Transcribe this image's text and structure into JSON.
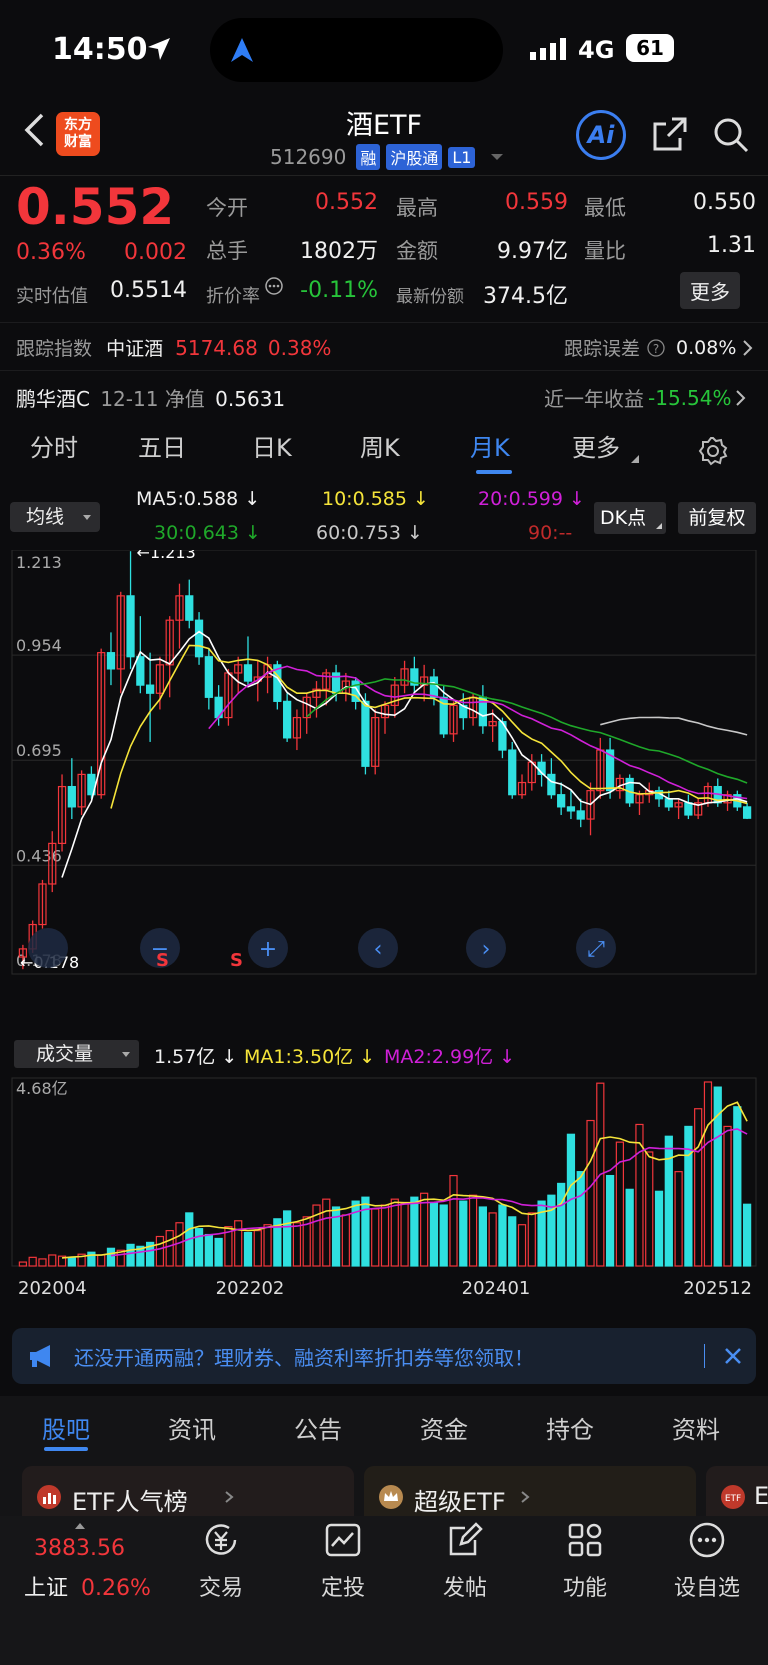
{
  "status_bar": {
    "time": "14:50",
    "network": "4G",
    "battery": "61"
  },
  "header": {
    "title": "酒ETF",
    "code": "512690",
    "badges": [
      "融",
      "沪股通",
      "L1"
    ],
    "logo_text": "东方\n财富",
    "ai_label": "Ai"
  },
  "quote": {
    "price": "0.552",
    "change_pct": "0.36%",
    "change_val": "0.002",
    "open_label": "今开",
    "open": "0.552",
    "high_label": "最高",
    "high": "0.559",
    "low_label": "最低",
    "low": "0.550",
    "volume_label": "总手",
    "volume": "1802万",
    "amount_label": "金额",
    "amount": "9.97亿",
    "ratio_label": "量比",
    "ratio": "1.31",
    "estimate_label": "实时估值",
    "estimate": "0.5514",
    "discount_label": "折价率",
    "discount": "-0.11%",
    "shares_label": "最新份额",
    "shares": "374.5亿",
    "more_button": "更多"
  },
  "tracking": {
    "label": "跟踪指数",
    "index_name": "中证酒",
    "index_value": "5174.68",
    "index_pct": "0.38%",
    "error_label": "跟踪误差",
    "error_value": "0.08%"
  },
  "fund": {
    "name": "鹏华酒C",
    "date": "12-11",
    "nav_label": "净值",
    "nav": "0.5631",
    "return_label": "近一年收益",
    "return_value": "-15.54%"
  },
  "period_tabs": [
    "分时",
    "五日",
    "日K",
    "周K",
    "月K",
    "更多"
  ],
  "active_tab": "月K",
  "ma_bar": {
    "selector": "均线",
    "ma5": "MA5:0.588",
    "ma10": "10:0.585",
    "ma20": "20:0.599",
    "ma30": "30:0.643",
    "ma60": "60:0.753",
    "ma90": "90:--",
    "dk_button": "DK点",
    "adjust_button": "前复权"
  },
  "volume_bar": {
    "selector": "成交量",
    "vol": "1.57亿",
    "ma1": "MA1:3.50亿",
    "ma2": "MA2:2.99亿"
  },
  "colors": {
    "up": "#f2363b",
    "down": "#2fe0e0",
    "ma5": "#ffffff",
    "ma10": "#f5e43a",
    "ma20": "#d020d8",
    "ma30": "#1fa82a",
    "ma60": "#c8c8c8",
    "accent": "#3f87f0"
  },
  "chart_data": {
    "type": "candlestick",
    "y_ticks": [
      "1.213",
      "0.954",
      "0.695",
      "0.436",
      "0.178"
    ],
    "max_label": "1.213",
    "min_label": "0.178",
    "ylim": [
      0.178,
      1.213
    ],
    "x_ticks": [
      "202004",
      "202202",
      "202401",
      "202512"
    ],
    "volume_max_label": "4.68亿",
    "candles": [
      [
        0.21,
        0.24,
        0.18,
        0.23
      ],
      [
        0.23,
        0.3,
        0.22,
        0.29
      ],
      [
        0.29,
        0.4,
        0.28,
        0.39
      ],
      [
        0.39,
        0.52,
        0.37,
        0.49
      ],
      [
        0.49,
        0.66,
        0.47,
        0.63
      ],
      [
        0.63,
        0.7,
        0.55,
        0.58
      ],
      [
        0.58,
        0.67,
        0.56,
        0.66
      ],
      [
        0.66,
        0.68,
        0.6,
        0.61
      ],
      [
        0.61,
        0.97,
        0.6,
        0.96
      ],
      [
        0.96,
        1.01,
        0.88,
        0.92
      ],
      [
        0.92,
        1.11,
        0.86,
        1.1
      ],
      [
        1.1,
        1.21,
        0.92,
        0.95
      ],
      [
        0.95,
        1.05,
        0.86,
        0.88
      ],
      [
        0.88,
        0.96,
        0.74,
        0.86
      ],
      [
        0.86,
        0.95,
        0.82,
        0.93
      ],
      [
        0.93,
        1.05,
        0.85,
        1.04
      ],
      [
        1.04,
        1.13,
        0.97,
        1.1
      ],
      [
        1.1,
        1.14,
        1.02,
        1.04
      ],
      [
        1.04,
        1.06,
        0.93,
        0.95
      ],
      [
        0.95,
        0.97,
        0.82,
        0.85
      ],
      [
        0.85,
        0.88,
        0.78,
        0.8
      ],
      [
        0.8,
        0.92,
        0.78,
        0.91
      ],
      [
        0.91,
        0.95,
        0.86,
        0.93
      ],
      [
        0.93,
        1.0,
        0.88,
        0.89
      ],
      [
        0.89,
        0.94,
        0.84,
        0.9
      ],
      [
        0.9,
        0.95,
        0.86,
        0.93
      ],
      [
        0.93,
        0.94,
        0.82,
        0.84
      ],
      [
        0.84,
        0.86,
        0.74,
        0.75
      ],
      [
        0.75,
        0.82,
        0.72,
        0.8
      ],
      [
        0.8,
        0.86,
        0.76,
        0.85
      ],
      [
        0.85,
        0.89,
        0.8,
        0.87
      ],
      [
        0.87,
        0.92,
        0.83,
        0.91
      ],
      [
        0.91,
        0.93,
        0.84,
        0.86
      ],
      [
        0.86,
        0.91,
        0.84,
        0.89
      ],
      [
        0.89,
        0.9,
        0.82,
        0.84
      ],
      [
        0.84,
        0.86,
        0.66,
        0.68
      ],
      [
        0.68,
        0.82,
        0.66,
        0.8
      ],
      [
        0.8,
        0.84,
        0.76,
        0.83
      ],
      [
        0.83,
        0.9,
        0.8,
        0.88
      ],
      [
        0.88,
        0.94,
        0.86,
        0.92
      ],
      [
        0.92,
        0.95,
        0.86,
        0.88
      ],
      [
        0.88,
        0.93,
        0.84,
        0.9
      ],
      [
        0.9,
        0.92,
        0.83,
        0.85
      ],
      [
        0.85,
        0.88,
        0.75,
        0.76
      ],
      [
        0.76,
        0.84,
        0.74,
        0.83
      ],
      [
        0.83,
        0.86,
        0.77,
        0.8
      ],
      [
        0.8,
        0.86,
        0.78,
        0.85
      ],
      [
        0.85,
        0.88,
        0.76,
        0.78
      ],
      [
        0.78,
        0.82,
        0.74,
        0.79
      ],
      [
        0.79,
        0.8,
        0.7,
        0.72
      ],
      [
        0.72,
        0.74,
        0.6,
        0.61
      ],
      [
        0.61,
        0.66,
        0.6,
        0.64
      ],
      [
        0.64,
        0.71,
        0.62,
        0.69
      ],
      [
        0.69,
        0.71,
        0.63,
        0.66
      ],
      [
        0.66,
        0.7,
        0.6,
        0.61
      ],
      [
        0.61,
        0.64,
        0.56,
        0.58
      ],
      [
        0.58,
        0.62,
        0.55,
        0.57
      ],
      [
        0.57,
        0.6,
        0.53,
        0.55
      ],
      [
        0.55,
        0.64,
        0.51,
        0.62
      ],
      [
        0.62,
        0.75,
        0.6,
        0.72
      ],
      [
        0.72,
        0.75,
        0.6,
        0.62
      ],
      [
        0.62,
        0.66,
        0.6,
        0.65
      ],
      [
        0.65,
        0.66,
        0.58,
        0.59
      ],
      [
        0.59,
        0.62,
        0.56,
        0.61
      ],
      [
        0.61,
        0.64,
        0.59,
        0.62
      ],
      [
        0.62,
        0.63,
        0.58,
        0.6
      ],
      [
        0.6,
        0.62,
        0.57,
        0.58
      ],
      [
        0.58,
        0.6,
        0.55,
        0.59
      ],
      [
        0.59,
        0.61,
        0.55,
        0.56
      ],
      [
        0.56,
        0.6,
        0.55,
        0.59
      ],
      [
        0.59,
        0.64,
        0.58,
        0.63
      ],
      [
        0.63,
        0.65,
        0.58,
        0.59
      ],
      [
        0.59,
        0.62,
        0.57,
        0.61
      ],
      [
        0.61,
        0.62,
        0.57,
        0.58
      ],
      [
        0.58,
        0.59,
        0.55,
        0.552
      ]
    ],
    "volumes": [
      0.1,
      0.22,
      0.18,
      0.28,
      0.25,
      0.2,
      0.3,
      0.35,
      0.28,
      0.45,
      0.4,
      0.55,
      0.5,
      0.6,
      0.75,
      0.9,
      1.1,
      1.35,
      0.95,
      0.8,
      0.7,
      1.0,
      1.15,
      0.85,
      0.9,
      1.05,
      1.2,
      1.4,
      1.1,
      1.25,
      1.55,
      1.7,
      1.5,
      1.3,
      1.65,
      1.75,
      1.45,
      1.55,
      1.7,
      1.6,
      1.75,
      1.85,
      1.6,
      1.55,
      2.3,
      1.65,
      1.8,
      1.5,
      1.35,
      1.55,
      1.25,
      1.05,
      1.35,
      1.65,
      1.8,
      2.1,
      3.35,
      2.4,
      3.7,
      4.65,
      2.3,
      3.15,
      1.95,
      3.6,
      2.9,
      1.9,
      3.3,
      2.4,
      3.55,
      4.0,
      4.68,
      4.55,
      3.55,
      4.05,
      1.57
    ],
    "ma_series": [
      "MA5",
      "10",
      "20",
      "30",
      "60"
    ]
  },
  "promo": {
    "text": "还没开通两融？理财券、融资利率折扣券等您领取！"
  },
  "content_tabs": [
    "股吧",
    "资讯",
    "公告",
    "资金",
    "持仓",
    "资料"
  ],
  "active_content_tab": "股吧",
  "cards": [
    "ETF人气榜",
    "超级ETF",
    "E"
  ],
  "bottom_nav": {
    "index_value": "3883.56",
    "index_name": "上证",
    "index_pct": "0.26%",
    "items": [
      "交易",
      "定投",
      "发帖",
      "功能",
      "设自选"
    ]
  }
}
